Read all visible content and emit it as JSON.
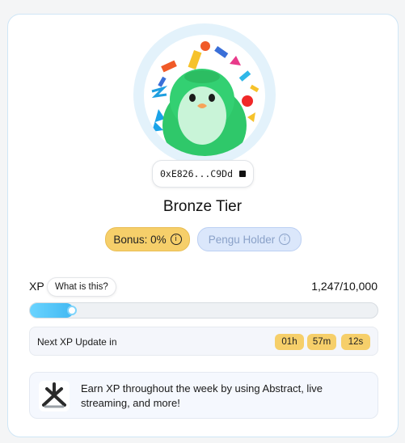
{
  "profile": {
    "wallet_address": "0xE826...C9Dd",
    "tier": "Bronze Tier"
  },
  "badges": {
    "bonus_label": "Bonus: 0%",
    "holder_label": "Pengu Holder"
  },
  "xp": {
    "label": "XP",
    "help_label": "What is this?",
    "value_text": "1,247/10,000",
    "progress_fraction": 0.1247
  },
  "next_update": {
    "label": "Next XP Update in",
    "hours": "01h",
    "minutes": "57m",
    "seconds": "12s"
  },
  "info": {
    "text": "Earn XP throughout the week by using Abstract, live streaming, and more!"
  },
  "colors": {
    "accent_blue": "#41b8f2",
    "badge_gold": "#f6cf6a",
    "badge_blue": "#dbe7fb"
  },
  "icons": [
    "copy-icon",
    "info-icon",
    "abstract-logo-icon"
  ]
}
